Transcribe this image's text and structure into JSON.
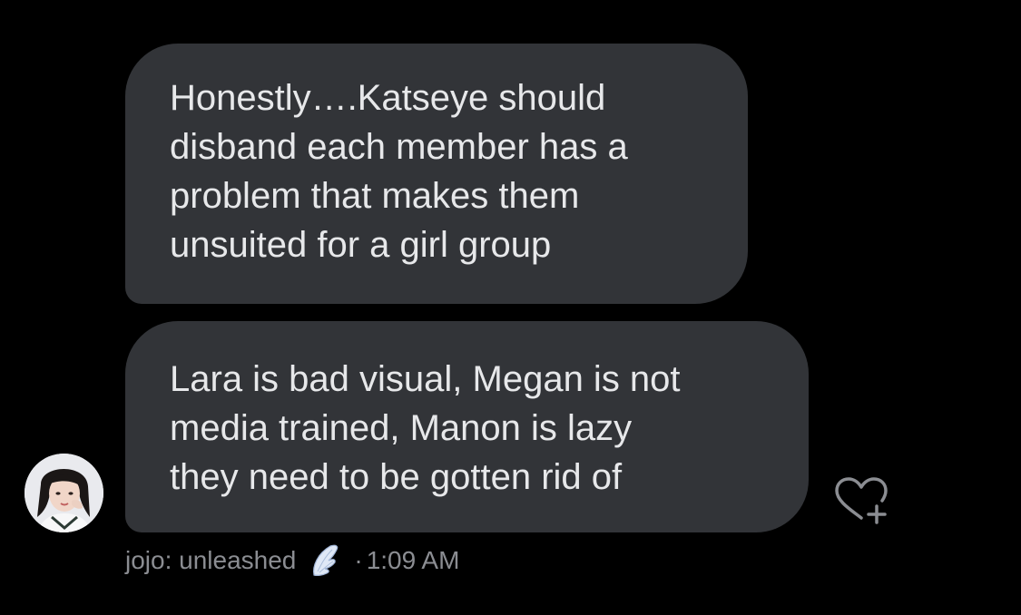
{
  "messages": [
    {
      "lines": [
        "Honestly….Katseye should",
        "disband each member has a",
        "problem that makes them",
        "unsuited for a girl group"
      ]
    },
    {
      "lines": [
        "Lara is bad visual, Megan is not",
        "media trained, Manon is lazy",
        "they need to be gotten rid of"
      ]
    }
  ],
  "sender": {
    "name": "jojo: unleashed",
    "badge_icon": "angel-wing-icon",
    "separator": "·",
    "time": "1:09 AM"
  },
  "reaction": {
    "icon": "heart-plus-icon"
  },
  "colors": {
    "background": "#000000",
    "bubble": "#323438",
    "bubble_text": "#e7e8ea",
    "meta_text": "#8b8d92"
  }
}
